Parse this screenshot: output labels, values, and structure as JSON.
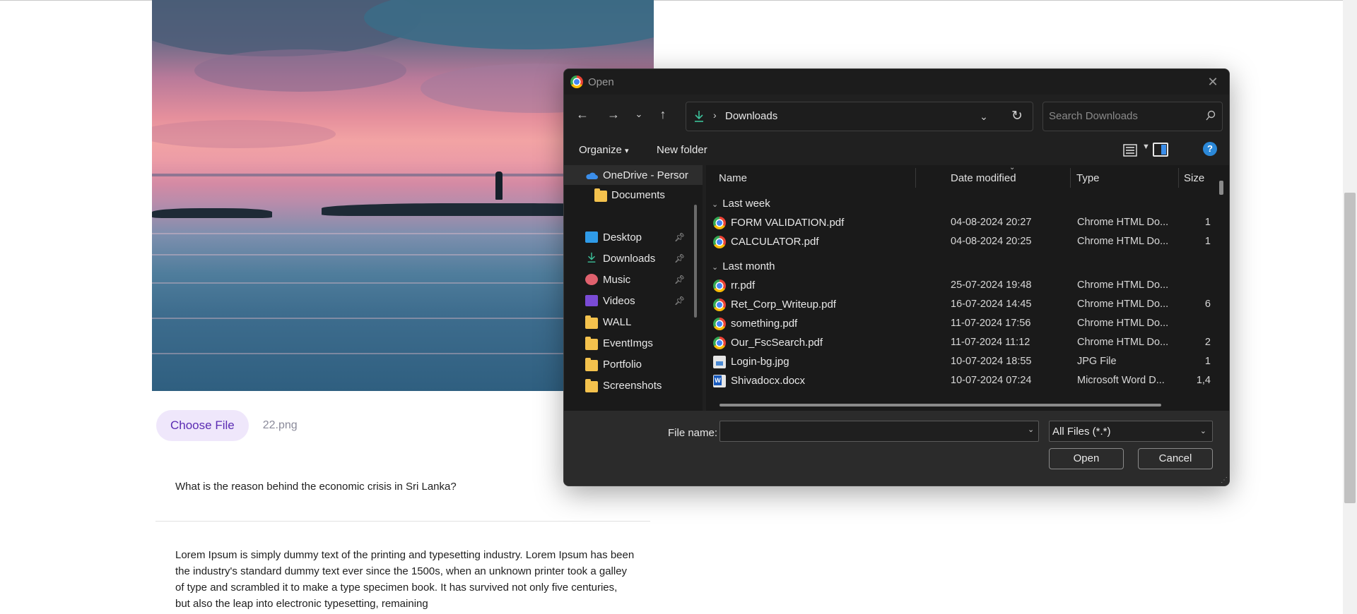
{
  "page": {
    "choose_file_label": "Choose File",
    "chosen_file_name": "22.png",
    "question": "What is the reason behind the economic crisis in Sri Lanka?",
    "paragraph": "Lorem Ipsum is simply dummy text of the printing and typesetting industry. Lorem Ipsum has been the industry's standard dummy text ever since the 1500s, when an unknown printer took a galley of type and scrambled it to make a type specimen book. It has survived not only five centuries, but also the leap into electronic typesetting, remaining"
  },
  "dialog": {
    "title": "Open",
    "address": {
      "path": "Downloads",
      "separator": "›"
    },
    "search_placeholder": "Search Downloads",
    "commands": {
      "organize": "Organize",
      "organize_caret": "▾",
      "new_folder": "New folder"
    },
    "nav_items": [
      {
        "label": "OneDrive - Persor",
        "icon": "onedrive-cloud-icon"
      },
      {
        "label": "Documents",
        "icon": "folder-icon"
      },
      {
        "label": "Desktop",
        "icon": "desktop-icon",
        "pinned": true
      },
      {
        "label": "Downloads",
        "icon": "download-icon",
        "pinned": true
      },
      {
        "label": "Music",
        "icon": "music-icon",
        "pinned": true
      },
      {
        "label": "Videos",
        "icon": "videos-icon",
        "pinned": true
      },
      {
        "label": "WALL",
        "icon": "folder-icon"
      },
      {
        "label": "EventImgs",
        "icon": "folder-icon"
      },
      {
        "label": "Portfolio",
        "icon": "folder-icon"
      },
      {
        "label": "Screenshots",
        "icon": "folder-icon"
      }
    ],
    "columns": {
      "name": "Name",
      "date": "Date modified",
      "type": "Type",
      "size": "Size"
    },
    "groups": [
      {
        "label": "Last week",
        "files": [
          {
            "name": "FORM VALIDATION.pdf",
            "date": "04-08-2024 20:27",
            "type": "Chrome HTML Do...",
            "size": "1",
            "icon": "chrome-icon"
          },
          {
            "name": "CALCULATOR.pdf",
            "date": "04-08-2024 20:25",
            "type": "Chrome HTML Do...",
            "size": "1",
            "icon": "chrome-icon"
          }
        ]
      },
      {
        "label": "Last month",
        "files": [
          {
            "name": "rr.pdf",
            "date": "25-07-2024 19:48",
            "type": "Chrome HTML Do...",
            "size": "",
            "icon": "chrome-icon"
          },
          {
            "name": "Ret_Corp_Writeup.pdf",
            "date": "16-07-2024 14:45",
            "type": "Chrome HTML Do...",
            "size": "6",
            "icon": "chrome-icon"
          },
          {
            "name": "something.pdf",
            "date": "11-07-2024 17:56",
            "type": "Chrome HTML Do...",
            "size": "",
            "icon": "chrome-icon"
          },
          {
            "name": "Our_FscSearch.pdf",
            "date": "11-07-2024 11:12",
            "type": "Chrome HTML Do...",
            "size": "2",
            "icon": "chrome-icon"
          },
          {
            "name": "Login-bg.jpg",
            "date": "10-07-2024 18:55",
            "type": "JPG File",
            "size": "1",
            "icon": "image-file-icon"
          },
          {
            "name": "Shivadocx.docx",
            "date": "10-07-2024 07:24",
            "type": "Microsoft Word D...",
            "size": "1,4",
            "icon": "word-file-icon"
          }
        ]
      }
    ],
    "file_name_label": "File name:",
    "file_name_value": "",
    "file_type_filter": "All Files (*.*)",
    "open_label": "Open",
    "cancel_label": "Cancel"
  }
}
